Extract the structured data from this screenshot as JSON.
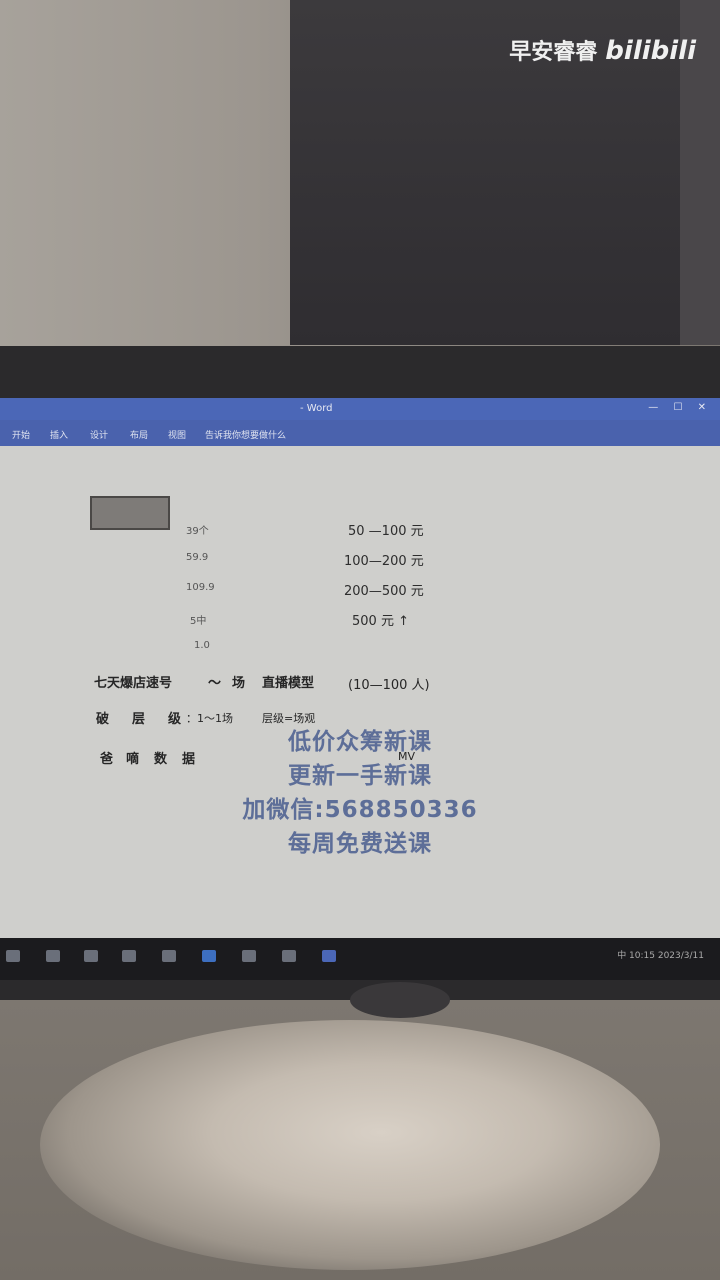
{
  "watermark": {
    "channel": "早安睿睿",
    "brand": "bilibili"
  },
  "window": {
    "title": "- Word",
    "controls": "— ☐ ✕"
  },
  "ribbon": {
    "tabs": [
      "开始",
      "插入",
      "设计",
      "布局",
      "视图",
      "告诉我你想要做什么"
    ]
  },
  "document": {
    "tiers": [
      {
        "label": "39个",
        "range": "50 —100 元"
      },
      {
        "label": "59.9",
        "range": "100—200 元"
      },
      {
        "label": "109.9",
        "range": "200—500 元"
      },
      {
        "label": "5中",
        "range": "500 元 ↑"
      },
      {
        "label": "1.0",
        "range": ""
      }
    ],
    "line1": {
      "a": "七天爆店速号",
      "b": "～",
      "c": "场",
      "d": "直播模型",
      "e": "(10—100 人)"
    },
    "line2": {
      "a": "破",
      "b": "层",
      "c": "级",
      "d": "：1～1场",
      "e": "层级=场观"
    },
    "line3": {
      "a": "爸",
      "b": "嘀",
      "c": "数",
      "d": "据",
      "e": "MV"
    }
  },
  "overlay": [
    "低价众筹新课",
    "更新一手新课",
    "加微信:568850336",
    "每周免费送课"
  ],
  "taskbar": {
    "tray_text": "中  10:15  2023/3/11"
  }
}
